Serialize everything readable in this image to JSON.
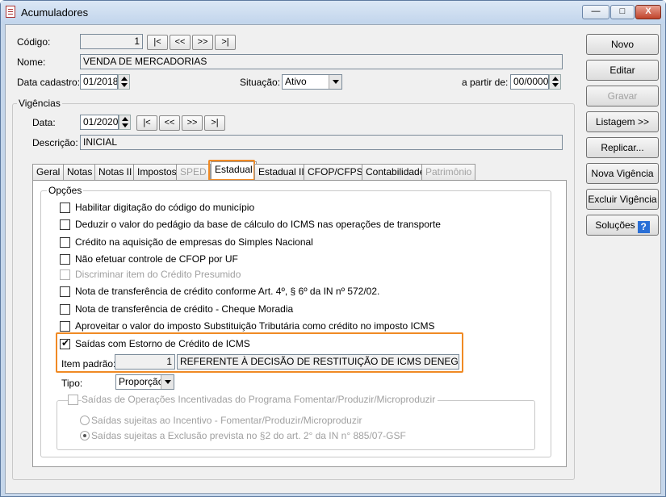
{
  "window": {
    "title": "Acumuladores",
    "controls": {
      "minimize": "—",
      "maximize": "□",
      "close": "X"
    }
  },
  "header": {
    "codigo_label": "Código:",
    "codigo_value": "1",
    "nav": [
      "|<",
      "<<",
      ">>",
      ">|"
    ],
    "nome_label": "Nome:",
    "nome_value": "VENDA DE MERCADORIAS",
    "data_cadastro_label": "Data cadastro:",
    "data_cadastro_value": "01/2018",
    "situacao_label": "Situação:",
    "situacao_value": "Ativo",
    "a_partir_label": "a partir de:",
    "a_partir_value": "00/0000"
  },
  "vigencias": {
    "title": "Vigências",
    "data_label": "Data:",
    "data_value": "01/2020",
    "nav": [
      "|<",
      "<<",
      ">>",
      ">|"
    ],
    "descricao_label": "Descrição:",
    "descricao_value": "INICIAL"
  },
  "tabs": [
    {
      "label": "Geral",
      "enabled": true
    },
    {
      "label": "Notas",
      "enabled": true
    },
    {
      "label": "Notas II",
      "enabled": true
    },
    {
      "label": "Impostos",
      "enabled": true
    },
    {
      "label": "SPED",
      "enabled": false
    },
    {
      "label": "Estadual",
      "enabled": true,
      "active": true
    },
    {
      "label": "Estadual II",
      "enabled": true
    },
    {
      "label": "CFOP/CFPS",
      "enabled": true
    },
    {
      "label": "Contabilidade",
      "enabled": true
    },
    {
      "label": "Patrimônio",
      "enabled": false
    }
  ],
  "opcoes": {
    "title": "Opções",
    "checkboxes": [
      {
        "label": "Habilitar digitação do código do município",
        "checked": false,
        "enabled": true
      },
      {
        "label": "Deduzir o valor do pedágio da base de cálculo do ICMS nas operações de transporte",
        "checked": false,
        "enabled": true
      },
      {
        "label": "Crédito na aquisição de empresas do Simples Nacional",
        "checked": false,
        "enabled": true
      },
      {
        "label": "Não efetuar controle de CFOP por UF",
        "checked": false,
        "enabled": true
      },
      {
        "label": "Discriminar item do Crédito Presumido",
        "checked": false,
        "enabled": false
      },
      {
        "label": "Nota de transferência de crédito conforme Art. 4º, § 6º da IN nº 572/02.",
        "checked": false,
        "enabled": true
      },
      {
        "label": "Nota de transferência de crédito - Cheque Moradia",
        "checked": false,
        "enabled": true
      },
      {
        "label": "Aproveitar o valor do imposto Substituição Tributária como crédito no imposto ICMS",
        "checked": false,
        "enabled": true
      },
      {
        "label": "Saídas com Estorno de Crédito de ICMS",
        "checked": true,
        "enabled": true
      }
    ],
    "item_padrao_label": "Item padrão:",
    "item_padrao_code": "1",
    "item_padrao_desc": "REFERENTE À DECISÃO DE RESTITUIÇÃO DE ICMS DENEGATÓRIA",
    "tipo_label": "Tipo:",
    "tipo_value": "Proporção",
    "fomentar": {
      "label": "Saídas de Operações Incentivadas do Programa Fomentar/Produzir/Microproduzir",
      "radios": [
        {
          "label": "Saídas sujeitas ao Incentivo - Fomentar/Produzir/Microproduzir",
          "checked": false
        },
        {
          "label": "Saídas sujeitas a Exclusão prevista no §2 do art. 2° da IN n° 885/07-GSF",
          "checked": true
        }
      ]
    }
  },
  "sidebar": [
    {
      "label": "Novo",
      "enabled": true
    },
    {
      "label": "Editar",
      "enabled": true
    },
    {
      "label": "Gravar",
      "enabled": false
    },
    {
      "label": "Listagem >>",
      "enabled": true
    },
    {
      "label": "Replicar...",
      "enabled": true
    },
    {
      "label": "Nova Vigência",
      "enabled": true
    },
    {
      "label": "Excluir Vigência",
      "enabled": true
    },
    {
      "label": "Soluções",
      "enabled": true,
      "icon": "help-icon"
    }
  ],
  "colors": {
    "highlight": "#f08a24",
    "title_bar": "#c5d6ea"
  }
}
